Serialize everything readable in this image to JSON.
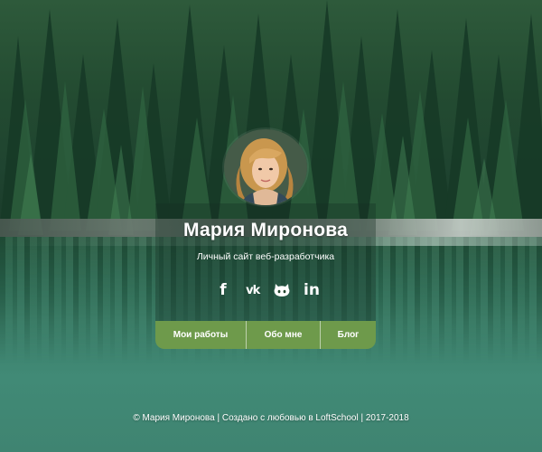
{
  "profile": {
    "name": "Мария Миронова",
    "subtitle": "Личный сайт веб-разработчика"
  },
  "socials": [
    {
      "icon": "facebook-icon",
      "glyph": "f"
    },
    {
      "icon": "vk-icon",
      "glyph": "vk"
    },
    {
      "icon": "github-icon",
      "glyph": ""
    },
    {
      "icon": "linkedin-icon",
      "glyph": "in"
    }
  ],
  "nav": {
    "items": [
      {
        "label": "Мои работы"
      },
      {
        "label": "Обо мне"
      },
      {
        "label": "Блог"
      }
    ]
  },
  "footer": {
    "text": "© Мария Миронова | Создано с любовью в LoftSchool | 2017-2018"
  },
  "colors": {
    "nav_button": "#6e9a4b",
    "card_overlay": "rgba(20,45,35,0.35)",
    "text": "#ffffff"
  }
}
